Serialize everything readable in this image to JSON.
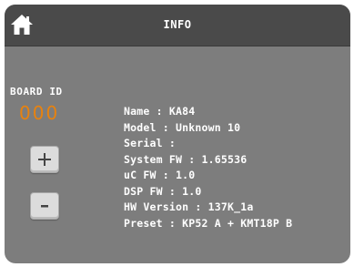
{
  "header": {
    "title": "INFO",
    "home_icon": "home-icon"
  },
  "board": {
    "label": "BOARD ID",
    "value": "000",
    "increment_label": "+",
    "decrement_label": "-"
  },
  "info": [
    "Name : KA84",
    "Model : Unknown 10",
    "Serial :",
    "System FW : 1.65536",
    "uC FW : 1.0",
    "DSP FW : 1.0",
    "HW Version : 137K_1a",
    "Preset : KP52 A + KMT18P B"
  ],
  "colors": {
    "background": "#7d7d7d",
    "header": "#4a4a4a",
    "accent": "#e8820e",
    "text": "#ffffff",
    "button": "#dcdcdc"
  }
}
